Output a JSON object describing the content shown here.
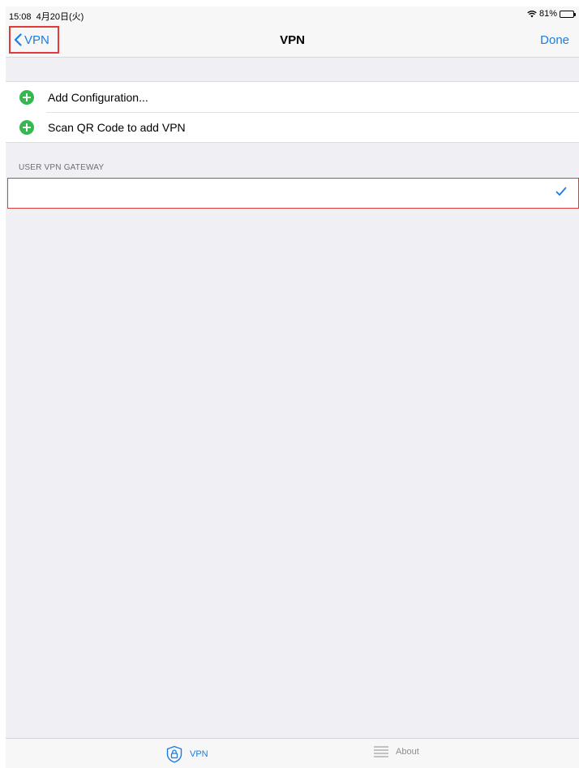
{
  "status_bar": {
    "time": "15:08",
    "date": "4月20日(火)",
    "battery": "81%",
    "battery_level": 0.81
  },
  "nav": {
    "back_label": "VPN",
    "title": "VPN",
    "done_label": "Done"
  },
  "actions": [
    {
      "label": "Add Configuration..."
    },
    {
      "label": "Scan QR Code to add VPN"
    }
  ],
  "section": {
    "header": "USER VPN GATEWAY",
    "rows": [
      {
        "label": "",
        "selected": true
      }
    ]
  },
  "tab_bar": {
    "tabs": [
      {
        "label": "VPN",
        "icon": "shield-lock-icon",
        "active": true
      },
      {
        "label": "About",
        "icon": "list-icon",
        "active": false
      }
    ]
  },
  "colors": {
    "accent": "#1a7ce5",
    "add_icon": "#34b84f",
    "highlight_border": "#e03a3a",
    "background": "#efeff4"
  }
}
